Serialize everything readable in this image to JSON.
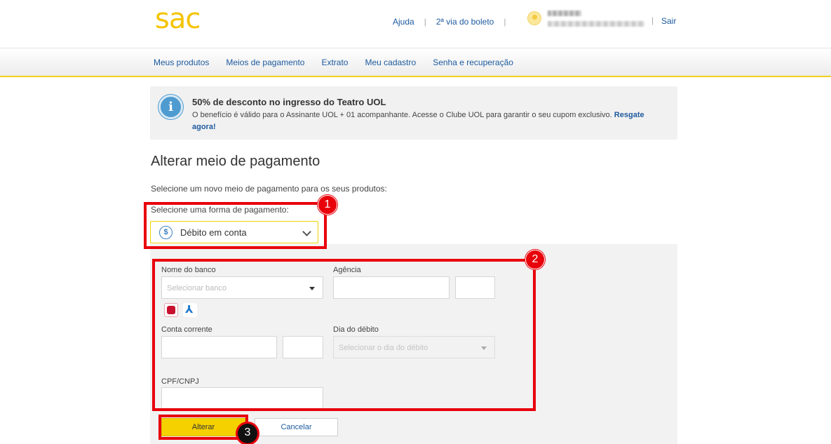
{
  "header": {
    "logo": "sac",
    "links": [
      "Ajuda",
      "2ª via do boleto"
    ],
    "logout": "Sair"
  },
  "nav": {
    "items": [
      "Meus produtos",
      "Meios de pagamento",
      "Extrato",
      "Meu cadastro",
      "Senha e recuperação"
    ]
  },
  "banner": {
    "title": "50% de desconto no ingresso do Teatro UOL",
    "text": "O benefício é válido para o Assinante UOL + 01 acompanhante. Acesse o Clube UOL para garantir o seu cupom exclusivo.",
    "link": "Resgate agora!"
  },
  "main": {
    "title": "Alterar meio de pagamento",
    "subtitle": "Selecione um novo meio de pagamento para os seus produtos:",
    "select_label": "Selecione uma forma de pagamento:",
    "select_value": "Débito em conta"
  },
  "form": {
    "bank_label": "Nome do banco",
    "bank_placeholder": "Selecionar banco",
    "agency_label": "Agência",
    "account_label": "Conta corrente",
    "debit_day_label": "Dia do débito",
    "debit_day_placeholder": "Selecionar o dia do débito",
    "cpf_label": "CPF/CNPJ"
  },
  "buttons": {
    "submit": "Alterar",
    "cancel": "Cancelar"
  },
  "annotations": [
    "1",
    "2",
    "3"
  ],
  "colors": {
    "brand_yellow": "#f5c400",
    "link_blue": "#1d5a9e",
    "highlight_red": "#e8000b"
  }
}
